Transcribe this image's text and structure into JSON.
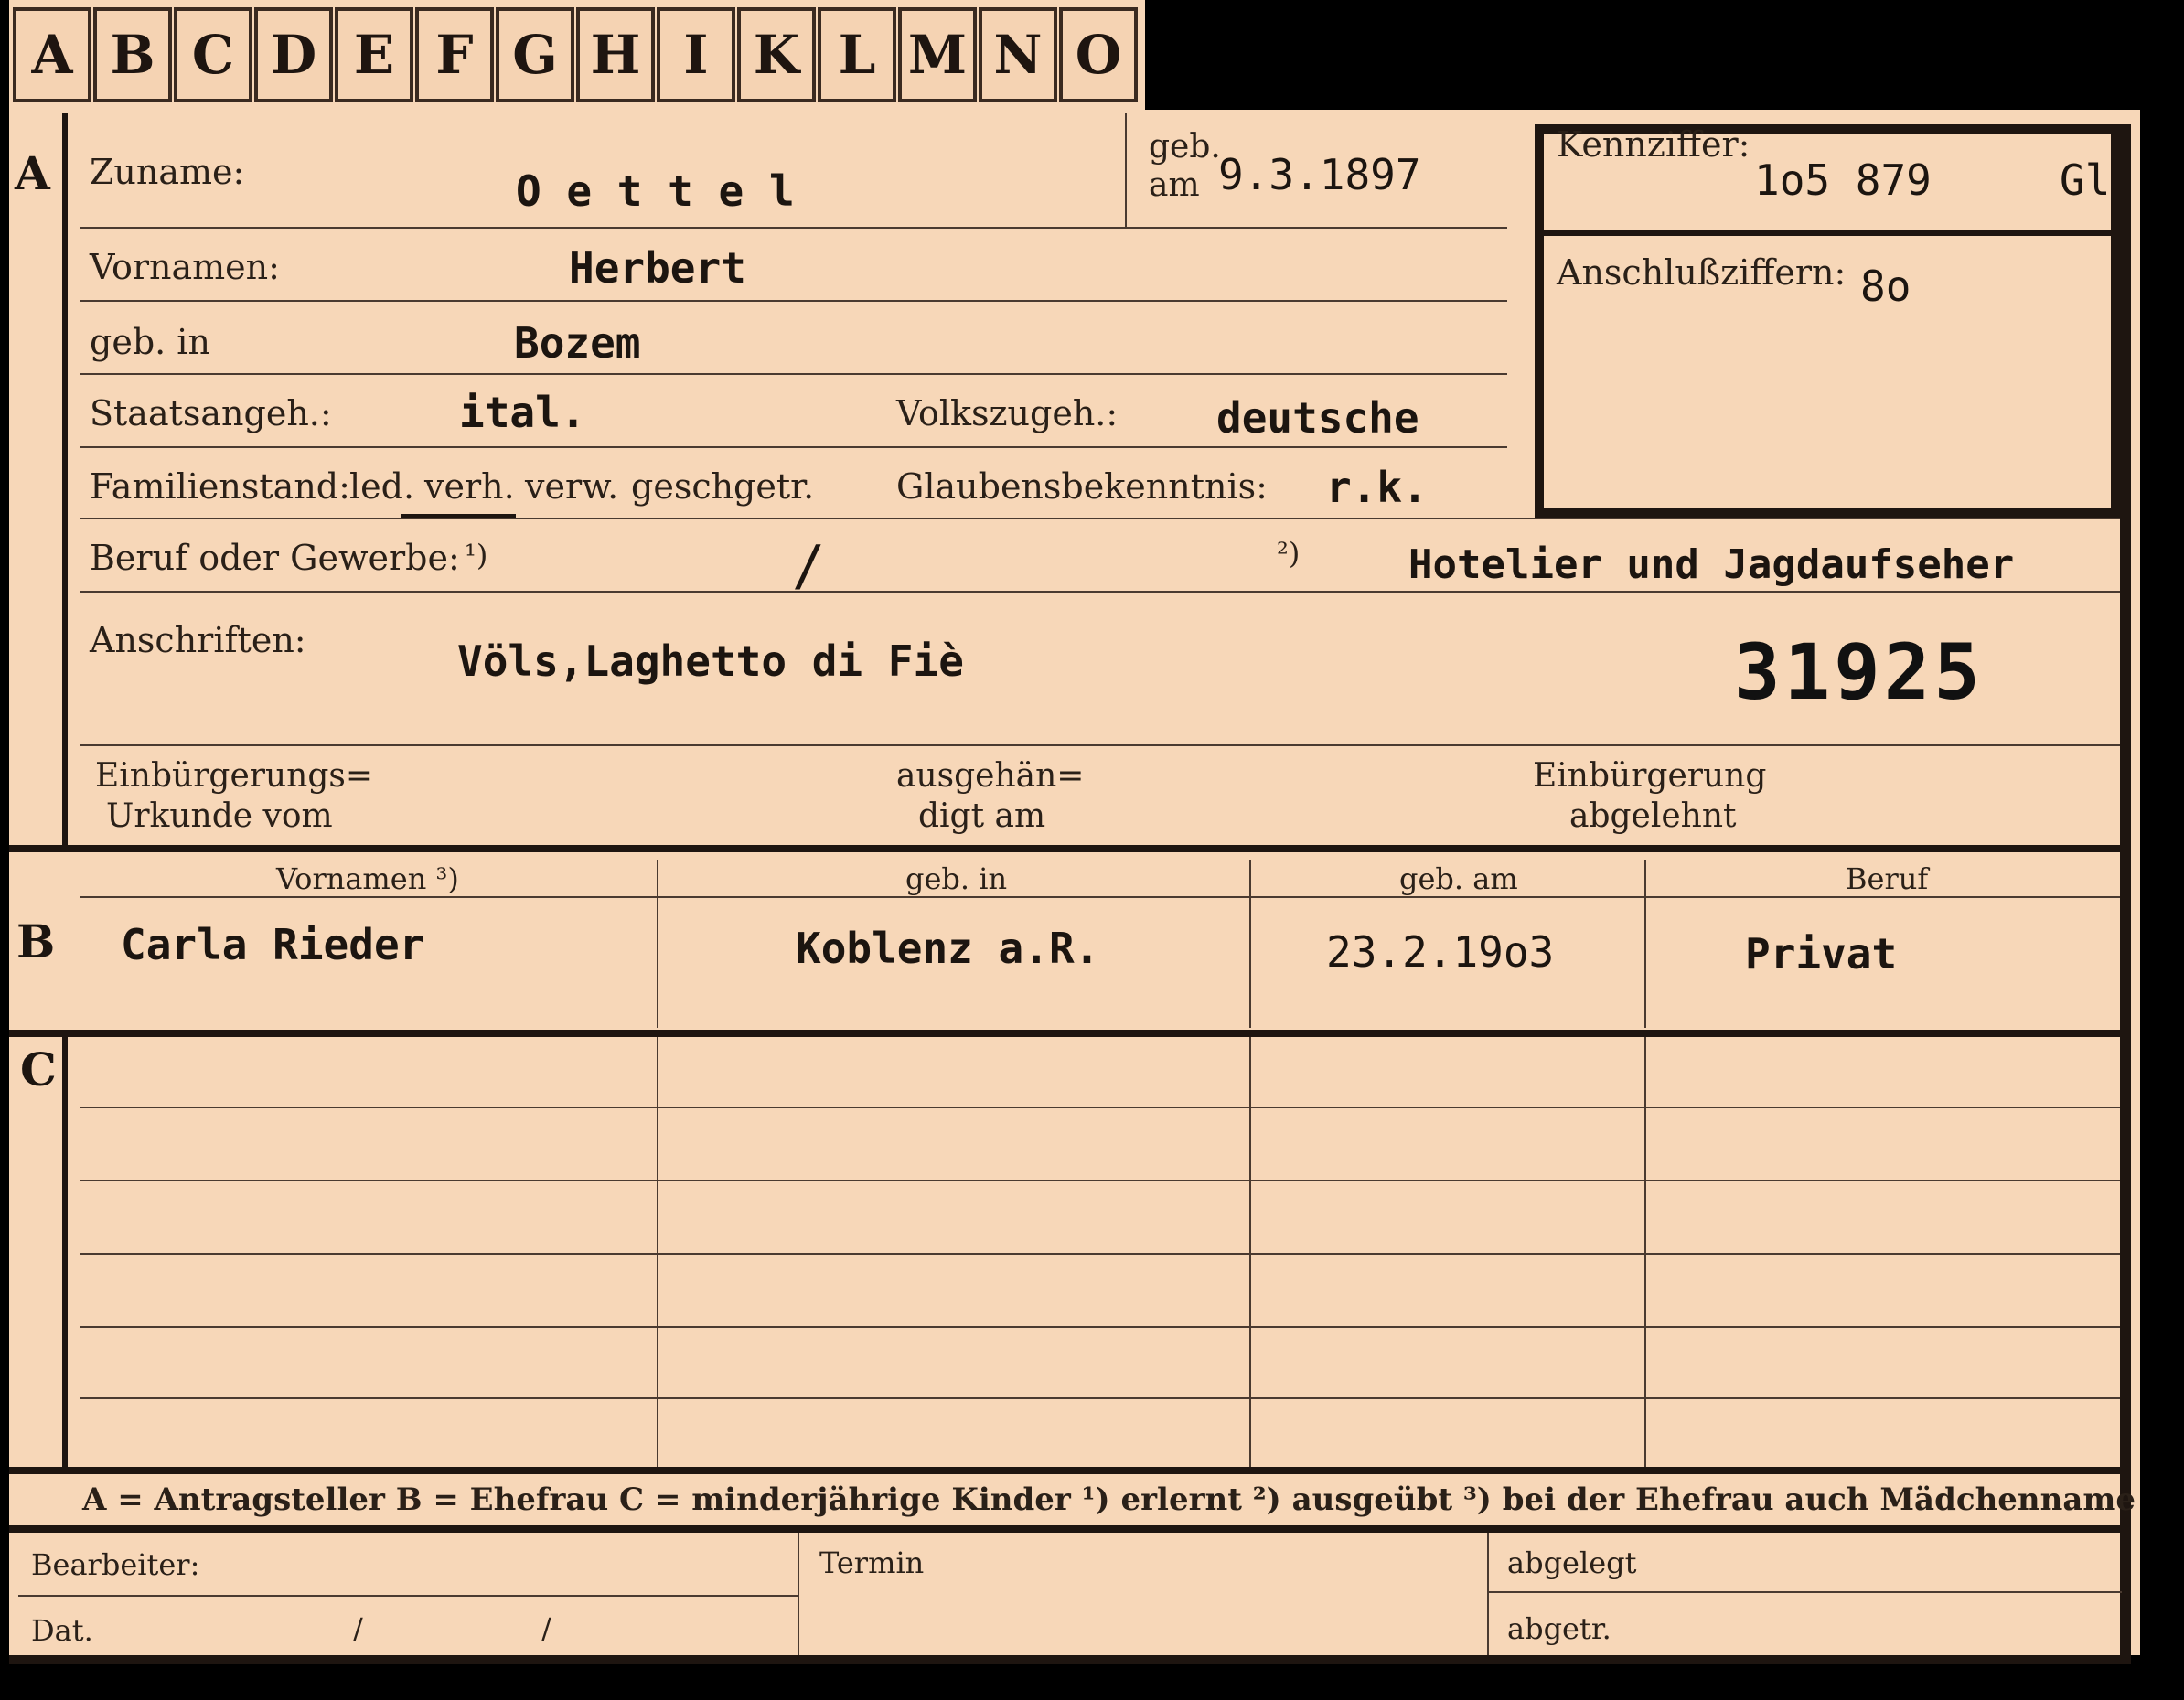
{
  "tabs": [
    "A",
    "B",
    "C",
    "D",
    "E",
    "F",
    "G",
    "H",
    "I",
    "K",
    "L",
    "M",
    "N",
    "O"
  ],
  "sections": {
    "a": "A",
    "b": "B",
    "c": "C"
  },
  "fields": {
    "zuname_label": "Zuname:",
    "zuname_value": "O e t t e l",
    "geb_am_label_1": "geb.",
    "geb_am_label_2": "am",
    "geb_am_value": "9.3.1897",
    "kennziffer_label": "Kennziffer:",
    "kennziffer_value": "1o5 879",
    "kennziffer_suffix": "Gl",
    "anschluss_label": "Anschlußziffern:",
    "anschluss_value": "8o",
    "vornamen_label": "Vornamen:",
    "vornamen_value": "Herbert",
    "geb_in_label": "geb. in",
    "geb_in_value": "Bozem",
    "staat_label": "Staatsangeh.:",
    "staat_value": "ital.",
    "volk_label": "Volkszugeh.:",
    "volk_value": "deutsche",
    "familie_label": "Familienstand:",
    "familie_options": [
      "led.",
      "verh.",
      "verw.",
      "gesch.",
      "getr."
    ],
    "glaube_label": "Glaubensbekenntnis:",
    "glaube_value": "r.k.",
    "beruf_label": "Beruf oder Gewerbe:",
    "beruf_note1": "¹)",
    "beruf_slash": "/",
    "beruf_note2": "²)",
    "beruf_value": "Hotelier und Jagdaufseher",
    "anschrift_label": "Anschriften:",
    "anschrift_value": "Völs,Laghetto di Fiè",
    "stamp_number": "31925",
    "urkunde_label_1": "Einbürgerungs=",
    "urkunde_label_2": "Urkunde vom",
    "ausgehaendigt_1": "ausgehän=",
    "ausgehaendigt_2": "digt am",
    "abgelehnt_1": "Einbürgerung",
    "abgelehnt_2": "abgelehnt"
  },
  "spouse_table": {
    "headers": [
      "Vornamen ³)",
      "geb. in",
      "geb. am",
      "Beruf"
    ],
    "row": [
      "Carla Rieder",
      "Koblenz a.R.",
      "23.2.19o3",
      "Privat"
    ]
  },
  "legend": "A = Antragsteller   B = Ehefrau   C = minderjährige Kinder   ¹) erlernt   ²) ausgeübt   ³) bei der Ehefrau auch Mädchenname",
  "footer": {
    "bearbeiter": "Bearbeiter:",
    "dat": "Dat.",
    "slash1": "/",
    "slash2": "/",
    "termin": "Termin",
    "abgelegt": "abgelegt",
    "abgetr": "abgetr."
  }
}
